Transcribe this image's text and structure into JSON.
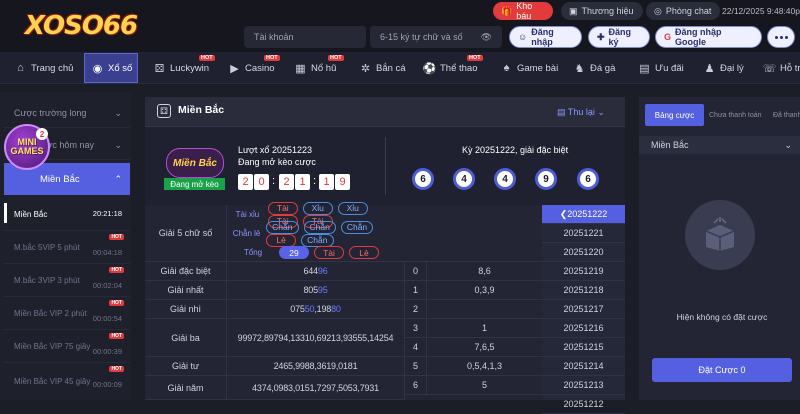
{
  "header": {
    "logo_text": "XOSO66",
    "kho_bau": "Kho báu",
    "thuong_hieu": "Thương hiệu",
    "phong_chat": "Phòng chat",
    "clock": "22/12/2025 9:48:40pm",
    "account_placeholder": "Tài khoản",
    "password_placeholder": "6-15 ký tự chữ và số",
    "login": "Đăng nhập",
    "register": "Đăng ký",
    "google_login": "Đăng nhập Google"
  },
  "nav": [
    "Trang chủ",
    "Xổ số",
    "Luckywin",
    "Casino",
    "Nổ hũ",
    "Bắn cá",
    "Thể thao",
    "Game bài",
    "Đá gà",
    "Ưu đãi",
    "Đại lý",
    "Hỗ trợ"
  ],
  "nav_hot": "HOT",
  "sidebar": {
    "cuoc_truong_long": "Cược trường long",
    "cuoc_hom_nay": "Cược hôm nay",
    "selected_region": "Miền Bắc",
    "minigames": [
      "MINI",
      "GAMES"
    ],
    "minigames_count": "2",
    "games": [
      {
        "name": "Miền Bắc",
        "time": "20:21:18",
        "hot": ""
      },
      {
        "name": "M.bắc 5VIP 5 phút",
        "time": "00:04:18",
        "hot": "HOT"
      },
      {
        "name": "M.bắc 3VIP 3 phút",
        "time": "00:02:04",
        "hot": "HOT"
      },
      {
        "name": "Miền Bắc VIP 2 phút",
        "time": "00:00:54",
        "hot": "HOT"
      },
      {
        "name": "Miền Bắc VIP 75 giây",
        "time": "00:00:39",
        "hot": "HOT"
      },
      {
        "name": "Miền Bắc VIP 45 giây",
        "time": "00:00:09",
        "hot": "HOT"
      }
    ]
  },
  "main": {
    "title": "Miền Bắc",
    "thu_lai": "Thu lại",
    "ball_label": "Miền Bắc",
    "open_badge": "Đang mở kèo",
    "luot_xo": "Lượt xổ 20251223",
    "dang_mo": "Đang mở kèo cược",
    "countdown": [
      "2",
      "0",
      "2",
      "1",
      "1",
      "9"
    ],
    "ky_title": "Kỳ 20251222, giải đặc biệt",
    "special_balls": [
      "6",
      "4",
      "4",
      "9",
      "6"
    ],
    "g5_label": "Giải 5 chữ số",
    "g5_rows": [
      {
        "k": "Tài xỉu",
        "pills": [
          "Tài",
          "Xỉu",
          "Xỉu",
          "Tài",
          "Tài"
        ],
        "types": [
          "r",
          "b",
          "b",
          "r",
          "r"
        ]
      },
      {
        "k": "Chẵn lẻ",
        "pills": [
          "Chẵn",
          "Chẵn",
          "Chẵn",
          "Lẻ",
          "Chẵn"
        ],
        "types": [
          "b",
          "b",
          "b",
          "r",
          "b"
        ]
      },
      {
        "k": "Tổng",
        "pills": [
          "29",
          "Tài",
          "Lẻ"
        ],
        "types": [
          "f",
          "r",
          "r"
        ]
      }
    ],
    "prizes": [
      {
        "name": "Giải đặc biệt",
        "pre": "644",
        "hi": "96",
        "dau": "0",
        "duoi": "8,6"
      },
      {
        "name": "Giải nhất",
        "pre": "805",
        "hi": "95",
        "dau": "1",
        "duoi": "0,3,9"
      },
      {
        "name": "Giải nhì",
        "pre": "075",
        "hi": "50",
        "mid": ",198",
        "hi2": "80",
        "dau": "2",
        "duoi": ""
      },
      {
        "name": "Giải ba",
        "text": "99972,89794,13310,69213,93555,14254",
        "dau": "3",
        "duoi": "1",
        "dau2": "4",
        "duoi2": "7,6,5"
      },
      {
        "name": "Giải tư",
        "text": "2465,9988,3619,0181",
        "dau": "5",
        "duoi": "0,5,4,1,3"
      },
      {
        "name": "Giải năm",
        "text": "4374,0983,0151,7297,5053,7931",
        "dau": "6",
        "duoi": "5"
      }
    ],
    "history": [
      "20251222",
      "20251221",
      "20251220",
      "20251219",
      "20251218",
      "20251217",
      "20251216",
      "20251215",
      "20251214",
      "20251213",
      "20251212"
    ]
  },
  "right": {
    "tabs": [
      "Bảng cược",
      "Chưa thanh toán",
      "Đã thanh"
    ],
    "region": "Miền Bắc",
    "empty_text": "Hiện không có đặt cược",
    "dat_cuoc": "Đặt Cược 0"
  },
  "colors": {
    "accent": "#5560e0",
    "hot": "#e33b3b",
    "bg": "#1b1d27"
  }
}
